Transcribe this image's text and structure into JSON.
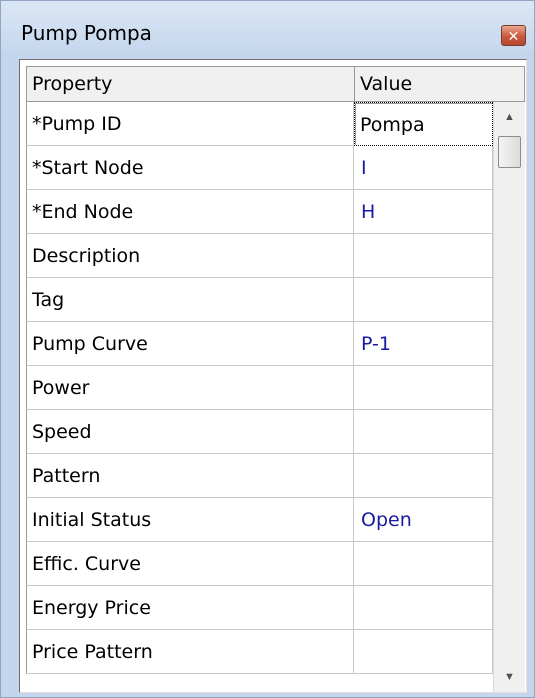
{
  "window": {
    "title": "Pump Pompa",
    "close_glyph": "✕"
  },
  "table": {
    "columns": [
      "Property",
      "Value"
    ],
    "rows": [
      {
        "property": "*Pump ID",
        "value": "Pompa"
      },
      {
        "property": "*Start Node",
        "value": "I"
      },
      {
        "property": "*End Node",
        "value": "H"
      },
      {
        "property": "Description",
        "value": ""
      },
      {
        "property": "Tag",
        "value": ""
      },
      {
        "property": "Pump Curve",
        "value": "P-1"
      },
      {
        "property": "Power",
        "value": ""
      },
      {
        "property": "Speed",
        "value": ""
      },
      {
        "property": "Pattern",
        "value": ""
      },
      {
        "property": "Initial Status",
        "value": "Open"
      },
      {
        "property": "Effic. Curve",
        "value": ""
      },
      {
        "property": "Energy Price",
        "value": ""
      },
      {
        "property": "Price Pattern",
        "value": ""
      }
    ]
  },
  "scrollbar": {
    "up_glyph": "▲",
    "down_glyph": "▼",
    "up_icon": "chevron-up-icon",
    "down_icon": "chevron-down-icon"
  },
  "colors": {
    "value_text": "#1a1aa0",
    "title_bar": "#c6d8ee",
    "close_button": "#c75a3e"
  }
}
